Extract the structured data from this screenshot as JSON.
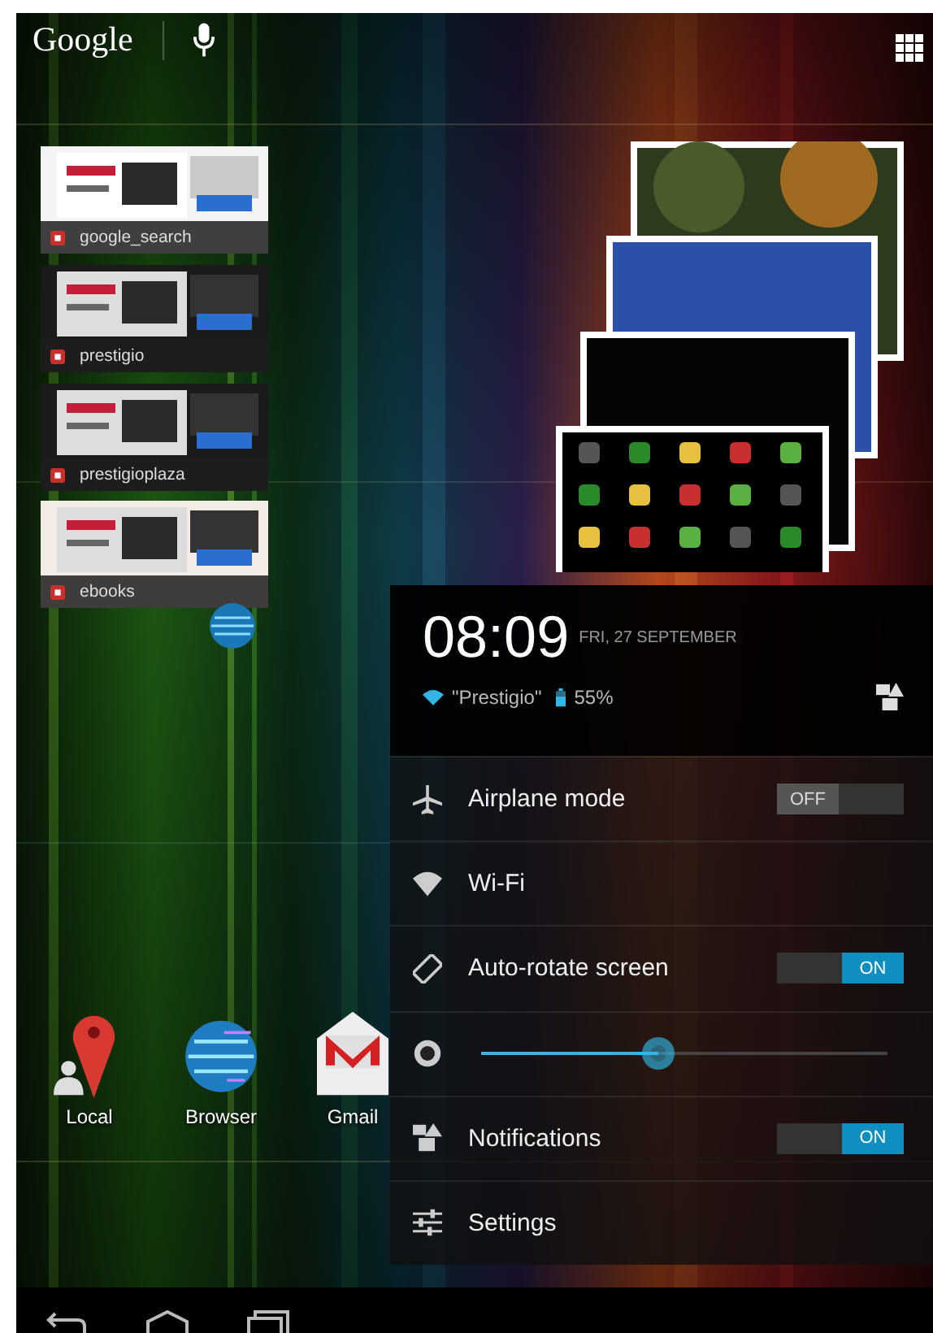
{
  "search_bar": {
    "logo": "Google"
  },
  "bookmarks": [
    {
      "title": "google_search"
    },
    {
      "title": "prestigio"
    },
    {
      "title": "prestigioplaza"
    },
    {
      "title": "ebooks"
    }
  ],
  "home_apps": [
    {
      "label": "Local"
    },
    {
      "label": "Browser"
    },
    {
      "label": "Gmail"
    }
  ],
  "quick_settings": {
    "time": "08:09",
    "date": "FRI, 27 SEPTEMBER",
    "network": "\"Prestigio\"",
    "battery": "55%",
    "rows": [
      {
        "kind": "toggle",
        "label": "Airplane mode",
        "on": false,
        "switch_text": "OFF"
      },
      {
        "kind": "link",
        "label": "Wi-Fi"
      },
      {
        "kind": "toggle",
        "label": "Auto-rotate screen",
        "on": true,
        "switch_text": "ON"
      },
      {
        "kind": "slider",
        "level": 0.42
      },
      {
        "kind": "toggle",
        "label": "Notifications",
        "on": true,
        "switch_text": "ON"
      },
      {
        "kind": "link",
        "label": "Settings"
      }
    ]
  }
}
